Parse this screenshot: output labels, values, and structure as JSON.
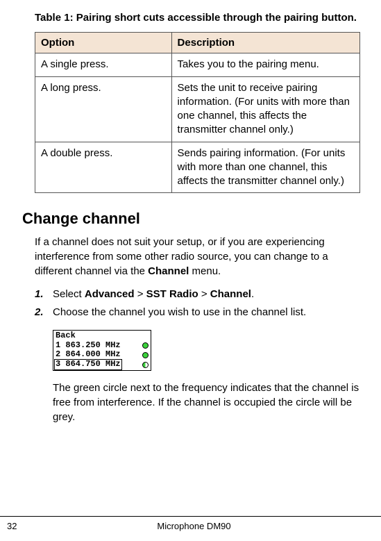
{
  "table": {
    "caption": "Table 1: Pairing short cuts accessible through the pairing button.",
    "headers": {
      "option": "Option",
      "description": "Description"
    },
    "rows": [
      {
        "option": "A single press.",
        "description": "Takes you to the pairing menu."
      },
      {
        "option": "A long press.",
        "description": "Sets the unit to receive pairing information. (For units with more than one channel, this affects the transmitter channel only.)"
      },
      {
        "option": "A double press.",
        "description": "Sends pairing information. (For units with more than one channel, this affects the transmitter channel only.)"
      }
    ]
  },
  "section": {
    "heading": "Change channel",
    "intro_pre": "If a channel does not suit your setup, or if you are experiencing interference from some other radio source, you can change to a different channel via the ",
    "intro_bold": "Channel",
    "intro_post": " menu."
  },
  "steps": {
    "s1": {
      "num": "1.",
      "w1": "Select ",
      "b1": "Advanced",
      "sep1": " > ",
      "b2": "SST Radio",
      "sep2": " > ",
      "b3": "Channel",
      "end": "."
    },
    "s2": {
      "num": "2.",
      "text": "Choose the channel you wish to use in the channel list."
    }
  },
  "lcd": {
    "back": "Back",
    "row1": "1 863.250 MHz",
    "row2": "2 864.000 MHz",
    "row3": "3 864.750 MHz"
  },
  "after_lcd": "The green circle next to the frequency indicates that the channel is free from interference. If the channel is occupied the circle will be grey.",
  "footer": {
    "page": "32",
    "title": "Microphone DM90"
  }
}
